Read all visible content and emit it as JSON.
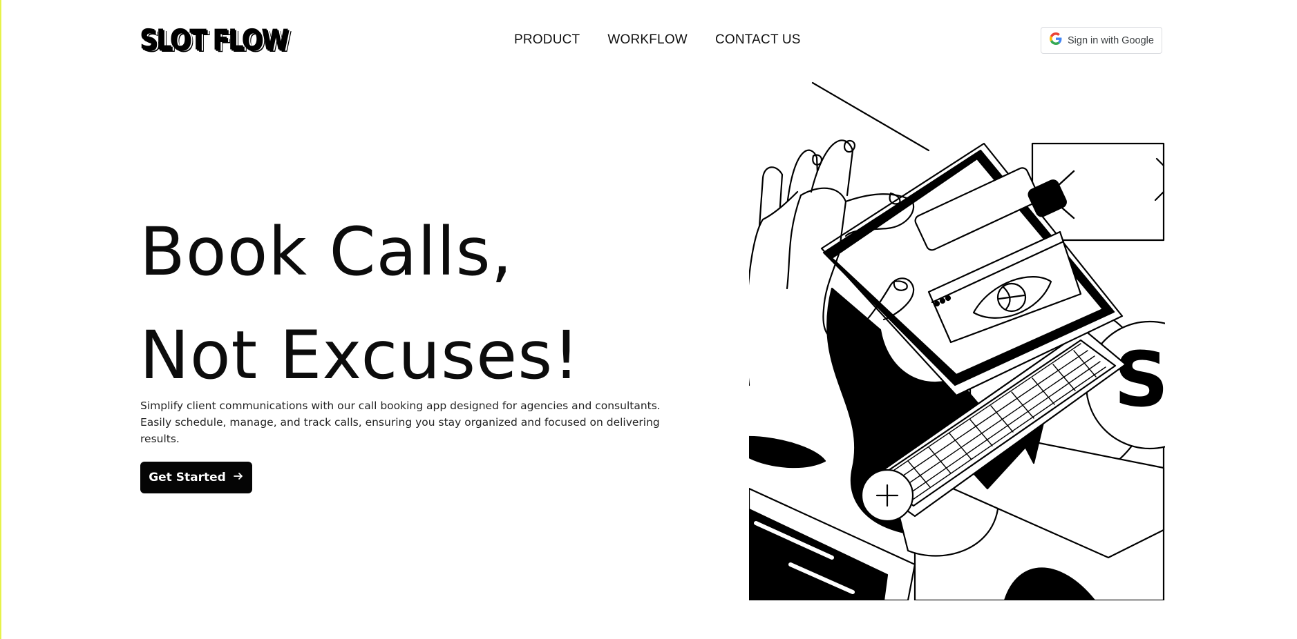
{
  "header": {
    "logo_text": "SLOT FLOW",
    "nav": [
      {
        "label": "PRODUCT"
      },
      {
        "label": "WORKFLOW"
      },
      {
        "label": "CONTACT US"
      }
    ],
    "google_signin_label": "Sign in with Google",
    "google_icon": "google-g-icon"
  },
  "hero": {
    "title_line1": "Book Calls,",
    "title_line2": "Not Excuses!",
    "description": "Simplify client communications with our call booking app designed for agencies and consultants. Easily schedule, manage, and track calls, ensuring you stay organized and focused on delivering results.",
    "cta_label": "Get Started",
    "cta_icon": "arrow-right-icon"
  },
  "illustration": {
    "badge_letter": "S",
    "description_icons": [
      "hand-icon",
      "laptop-icon",
      "eye-icon",
      "cursor-arrow-icon",
      "plus-icon",
      "code-brackets-icon"
    ]
  },
  "colors": {
    "accent_border": "#e6f24a",
    "cta_bg": "#050505",
    "text": "#0c0c0c"
  }
}
